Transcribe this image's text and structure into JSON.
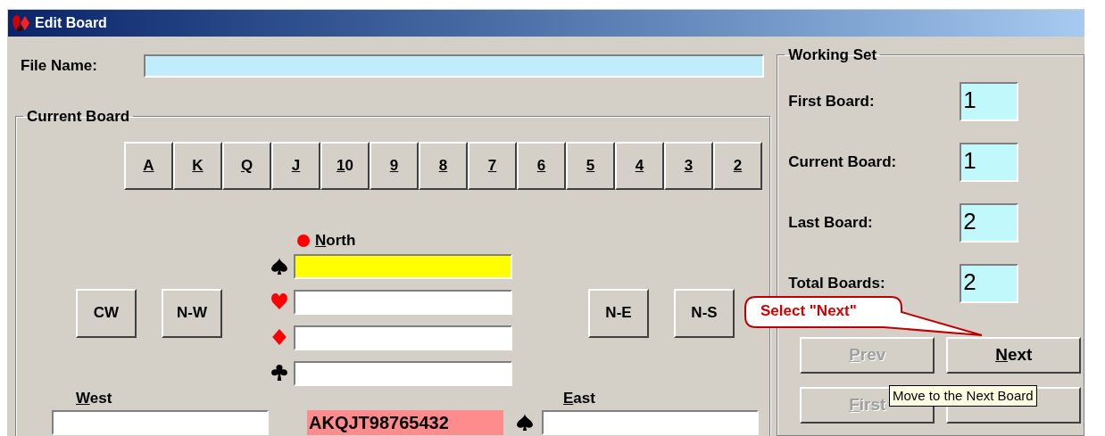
{
  "window": {
    "title": "Edit Board"
  },
  "file_name": {
    "label": "File Name:"
  },
  "current_board": {
    "title": "Current Board",
    "rank_buttons": [
      "A",
      "K",
      "Q",
      "J",
      "10",
      "9",
      "8",
      "7",
      "6",
      "5",
      "4",
      "3",
      "2"
    ],
    "left_buttons": [
      "CW",
      "N-W"
    ],
    "right_buttons": [
      "N-E",
      "N-S"
    ],
    "north": {
      "label": "North",
      "dealer": true,
      "suits": [
        {
          "kind": "spades",
          "selected": true
        },
        {
          "kind": "hearts",
          "selected": false
        },
        {
          "kind": "diamonds",
          "selected": false
        },
        {
          "kind": "clubs",
          "selected": false
        }
      ]
    },
    "west": {
      "label": "West"
    },
    "south_field": {
      "value": "AKQJT98765432",
      "highlighted": true
    },
    "east": {
      "label": "East",
      "kind": "spades"
    }
  },
  "working_set": {
    "title": "Working Set",
    "fields": [
      {
        "label": "First Board:",
        "value": "1"
      },
      {
        "label": "Current Board:",
        "value": "1"
      },
      {
        "label": "Last Board:",
        "value": "2"
      },
      {
        "label": "Total Boards:",
        "value": "2"
      }
    ]
  },
  "nav_buttons": [
    {
      "label": "Prev",
      "disabled": true
    },
    {
      "label": "Next",
      "disabled": false
    },
    {
      "label": "First",
      "disabled": true
    }
  ],
  "callout": {
    "text": "Select \"Next\""
  },
  "tooltip": {
    "text": "Move to the Next Board"
  }
}
